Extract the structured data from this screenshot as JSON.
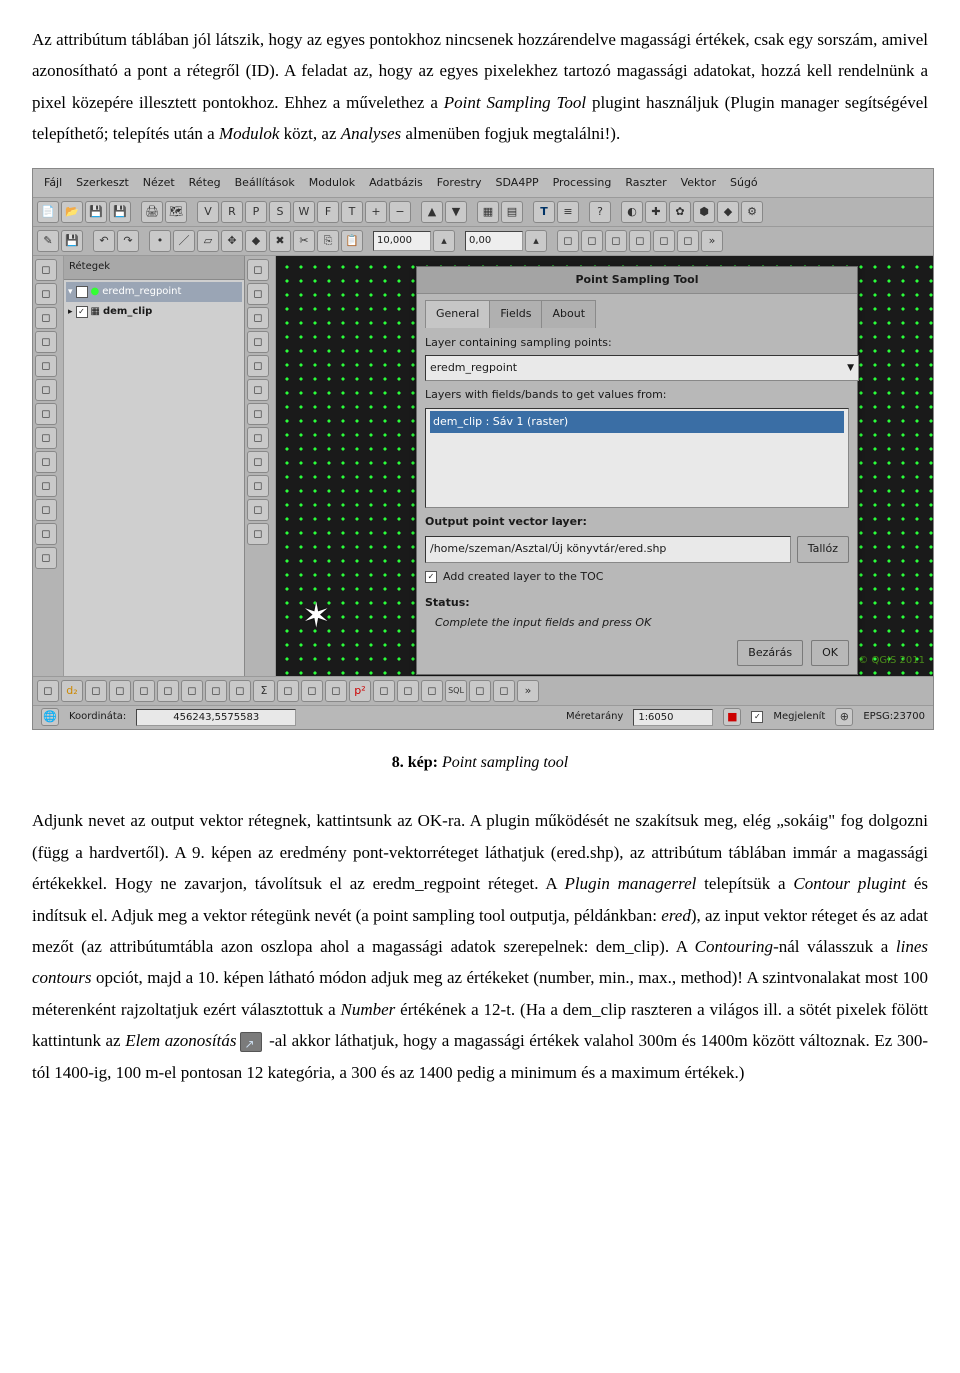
{
  "para1": "Az attribútum táblában jól látszik, hogy az egyes pontokhoz nincsenek hozzárendelve magassági értékek, csak egy sorszám, amivel azonosítható a pont a rétegről (ID). A feladat az, hogy az egyes pixelekhez tartozó magassági adatokat, hozzá kell rendelnünk a pixel közepére illesztett pontokhoz. Ehhez a művelethez a ",
  "para1_i1": "Point Sampling Tool",
  "para1_mid": " plugint használjuk (Plugin manager segítségével telepíthető; telepítés után a ",
  "para1_i2": "Modulok",
  "para1_mid2": " közt, az ",
  "para1_i3": "Analyses",
  "para1_end": " almenüben fogjuk megtalálni!).",
  "caption_num": "8. kép:",
  "caption_txt": " Point sampling tool",
  "para2_a": "Adjunk nevet az output vektor rétegnek, kattintsunk az OK-ra. A plugin működését ne szakítsuk meg, elég „sokáig\" fog dolgozni (függ a hardvertől). A 9. képen az eredmény pont-vektorréteget láthatjuk (ered.shp), az attribútum táblában immár a magassági értékekkel. Hogy ne zavarjon, távolítsuk el az eredm_regpoint réteget. A ",
  "para2_i1": "Plugin managerrel",
  "para2_b": " telepítsük a ",
  "para2_i2": "Contour plugint",
  "para2_c": " és indítsuk el. Adjuk meg a vektor rétegünk nevét (a point sampling tool outputja, példánkban: ",
  "para2_i3": "ered",
  "para2_d": "), az input vektor réteget és az adat mezőt (az attribútumtábla azon oszlopa ahol a magassági adatok szerepelnek: dem_clip). A ",
  "para2_i4": "Contouring",
  "para2_e": "-nál válasszuk a ",
  "para2_i5": "lines contours",
  "para2_f": " opciót, majd a 10. képen látható módon adjuk meg az értékeket (number, min., max., method)! A szintvonalakat most 100 méterenként rajzoltatjuk ezért választottuk a ",
  "para2_i6": "Number",
  "para2_g": " értékének a 12-t. (Ha a dem_clip raszteren a világos ill. a sötét pixelek fölött kattintunk az ",
  "para2_i7": "Elem azonosítás",
  "para2_h": " -al  akkor  láthatjuk,  hogy  a magassági értékek valahol 300m és 1400m között változnak. Ez 300-tól 1400-ig, 100 m-el pontosan 12 kategória, a 300 és az 1400 pedig a minimum és a maximum értékek.)",
  "menus": [
    "Fájl",
    "Szerkeszt",
    "Nézet",
    "Réteg",
    "Beállítások",
    "Modulok",
    "Adatbázis",
    "Forestry",
    "SDA4PP",
    "Processing",
    "Raszter",
    "Vektor",
    "Súgó"
  ],
  "tool_input1": "10,000",
  "tool_input2": "0,00",
  "layers_title": "Rétegek",
  "layer1": "eredm_regpoint",
  "layer2": "dem_clip",
  "dialog": {
    "title": "Point Sampling Tool",
    "tabs": [
      "General",
      "Fields",
      "About"
    ],
    "label_points": "Layer containing sampling points:",
    "select_points": "eredm_regpoint",
    "label_layers": "Layers with fields/bands to get values from:",
    "list_item": "dem_clip : Sáv 1 (raster)",
    "label_output": "Output point vector layer:",
    "output_path": "/home/szeman/Asztal/Új könyvtár/ered.shp",
    "browse": "Tallóz",
    "add_toc": "Add created layer to the TOC",
    "status": "Status:",
    "status_msg": "Complete the input fields and press OK",
    "close": "Bezárás",
    "ok": "OK"
  },
  "qgis_copy": "© QGIS 2011",
  "status": {
    "coord_label": "Koordináta:",
    "coord_val": "456243,5575583",
    "scale_label": "Méretarány",
    "scale_val": "1:6050",
    "render": "Megjelenít",
    "epsg": "EPSG:23700"
  }
}
